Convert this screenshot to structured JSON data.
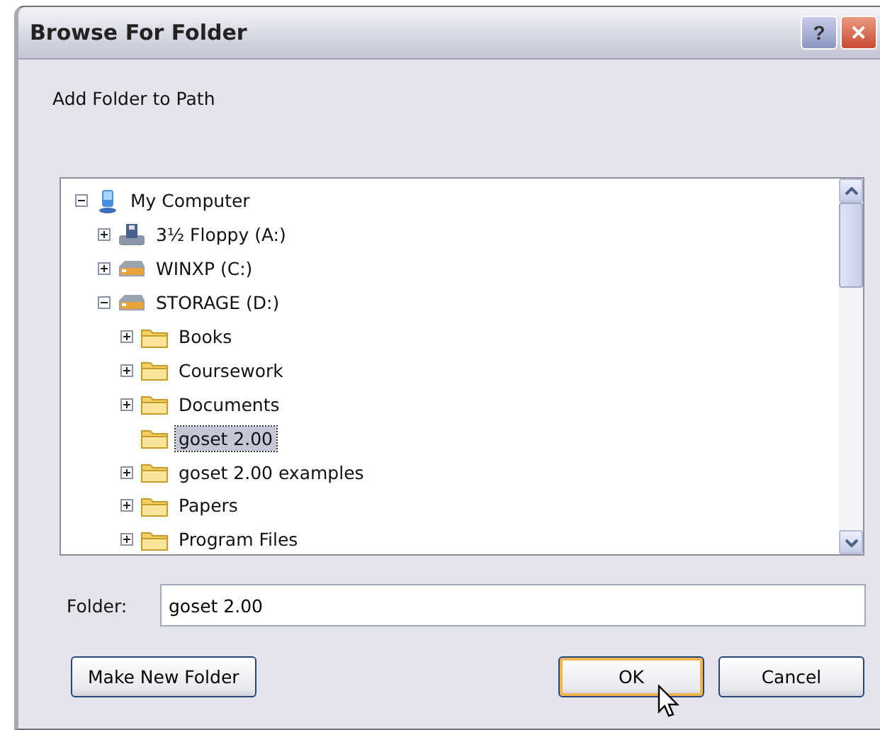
{
  "window": {
    "title": "Browse For Folder",
    "help_button": "?",
    "close_button": "✕"
  },
  "description": "Add Folder to Path",
  "tree": [
    {
      "label": "My Computer",
      "kind": "computer",
      "expanded": true,
      "selected": false,
      "children": [
        {
          "label": "3½ Floppy (A:)",
          "kind": "floppy",
          "expanded": false,
          "selected": false
        },
        {
          "label": "WINXP (C:)",
          "kind": "drive",
          "expanded": false,
          "selected": false
        },
        {
          "label": "STORAGE (D:)",
          "kind": "drive",
          "expanded": true,
          "selected": false,
          "children": [
            {
              "label": "Books",
              "kind": "folder",
              "expanded": false,
              "selected": false
            },
            {
              "label": "Coursework",
              "kind": "folder",
              "expanded": false,
              "selected": false
            },
            {
              "label": "Documents",
              "kind": "folder",
              "expanded": false,
              "selected": false
            },
            {
              "label": "goset 2.00",
              "kind": "folder",
              "selected": true
            },
            {
              "label": "goset 2.00 examples",
              "kind": "folder",
              "expanded": false,
              "selected": false
            },
            {
              "label": "Papers",
              "kind": "folder",
              "expanded": false,
              "selected": false
            },
            {
              "label": "Program Files",
              "kind": "folder",
              "expanded": false,
              "selected": false
            }
          ]
        }
      ]
    }
  ],
  "folder_field": {
    "label": "Folder:",
    "value": "goset 2.00"
  },
  "buttons": [
    {
      "label": "Make New Folder",
      "default": false
    },
    {
      "label": "OK",
      "default": true
    },
    {
      "label": "Cancel",
      "default": false
    }
  ]
}
